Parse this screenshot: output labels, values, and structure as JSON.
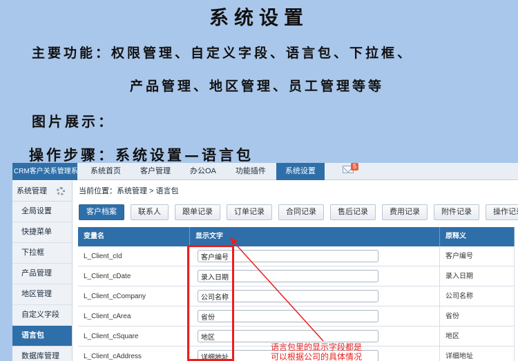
{
  "slide": {
    "title": "系统设置",
    "line1": "主要功能：权限管理、自定义字段、语言包、下拉框、",
    "line2": "产品管理、地区管理、员工管理等等",
    "line3": "图片展示：",
    "line4": "操作步骤：系统设置—语言包"
  },
  "app": {
    "brand": "CRM客户关系管理系统",
    "nav": [
      "系统首页",
      "客户管理",
      "办公OA",
      "功能插件",
      "系统设置"
    ],
    "mail_badge": "5",
    "sidebar_title": "系统管理",
    "sidebar": [
      "全局设置",
      "快捷菜单",
      "下拉框",
      "产品管理",
      "地区管理",
      "自定义字段",
      "语言包",
      "数据库管理"
    ],
    "breadcrumb": "当前位置：系统管理 > 语言包",
    "tabs": [
      "客户档案",
      "联系人",
      "跟单记录",
      "订单记录",
      "合同记录",
      "售后记录",
      "费用记录",
      "附件记录",
      "操作记录"
    ],
    "columns": [
      "变量名",
      "显示文字",
      "原释义"
    ],
    "rows": [
      {
        "var": "L_Client_cId",
        "text": "客户编号",
        "orig": "客户编号"
      },
      {
        "var": "L_Client_cDate",
        "text": "录入日期",
        "orig": "录入日期"
      },
      {
        "var": "L_Client_cCompany",
        "text": "公司名称",
        "orig": "公司名称"
      },
      {
        "var": "L_Client_cArea",
        "text": "省份",
        "orig": "省份"
      },
      {
        "var": "L_Client_cSquare",
        "text": "地区",
        "orig": "地区"
      },
      {
        "var": "L_Client_cAddress",
        "text": "详细地址",
        "orig": "详细地址"
      }
    ]
  },
  "annotation": {
    "line1": "语言包里的显示字段都是",
    "line2": "可以根据公司的具体情况"
  },
  "colors": {
    "accent": "#2f6fa9",
    "annotation": "#ee1c1c",
    "background": "#a9c7ea"
  }
}
